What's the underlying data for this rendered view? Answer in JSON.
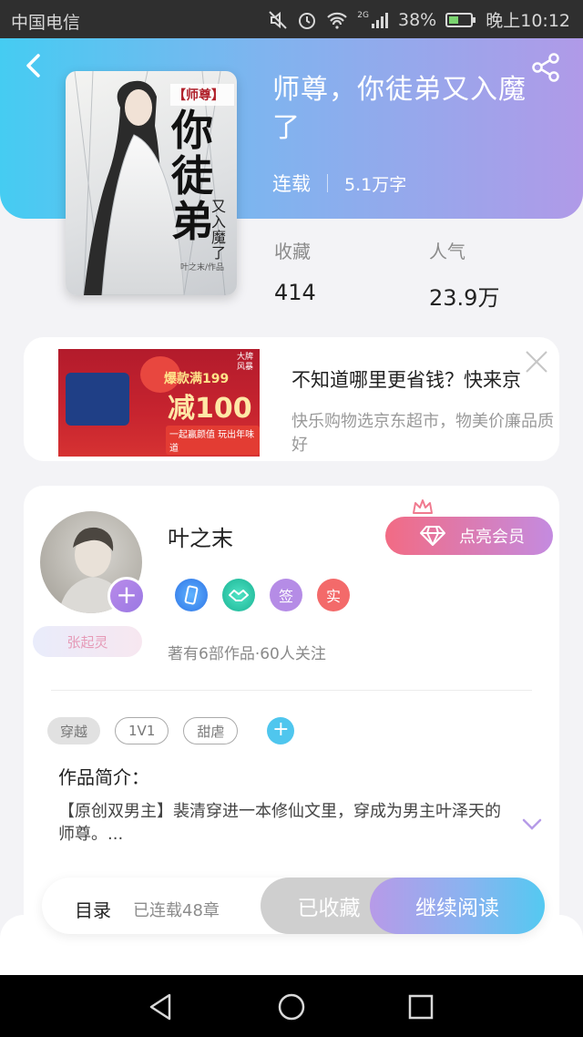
{
  "status_bar": {
    "carrier": "中国电信",
    "network": "2G",
    "battery": "38%",
    "time": "晚上10:12"
  },
  "book": {
    "title": "师尊，你徒弟又入魔了",
    "status": "连载",
    "word_count": "5.1万字",
    "stats": [
      {
        "label": "收藏",
        "value": "414"
      },
      {
        "label": "人气",
        "value": "23.9万"
      }
    ],
    "cover": {
      "tag": "【师尊】",
      "title_chars": [
        "你",
        "徒",
        "弟"
      ],
      "sub_title": "又入魔了",
      "author_credit": "叶之末/作品"
    }
  },
  "ad": {
    "title": "不知道哪里更省钱？快来京",
    "description": "快乐购物选京东超市，物美价廉品质好",
    "banner_top": "爆款满199",
    "banner_main": "减100",
    "banner_sub": "一起赢颜值 玩出年味道",
    "banner_corner": "大牌风暴"
  },
  "author": {
    "name": "叶之末",
    "vip_label": "点亮会员",
    "fan_label": "张起灵",
    "stats": "著有6部作品·60人关注",
    "badges": [
      {
        "icon": "phone-icon",
        "color": "#3f8df0"
      },
      {
        "icon": "handshake-icon",
        "color": "#25c3a6"
      },
      {
        "label": "签",
        "color": "#b58ce6"
      },
      {
        "label": "实",
        "color": "#f36a6a"
      }
    ]
  },
  "tags": [
    "穿越",
    "1V1",
    "甜虐"
  ],
  "intro": {
    "label": "作品简介：",
    "text": "【原创双男主】裴清穿进一本修仙文里，穿成为男主叶泽天的师尊。..."
  },
  "actions": {
    "toc": "目录",
    "chapters": "已连载48章",
    "collect": "已收藏",
    "read": "继续阅读"
  }
}
